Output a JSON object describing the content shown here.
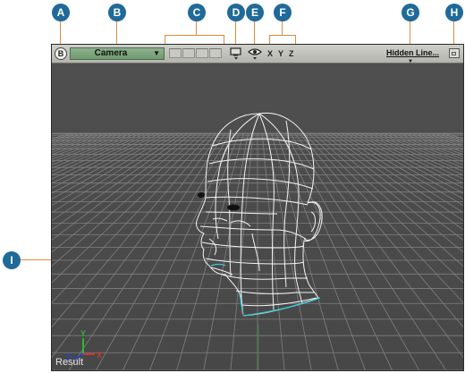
{
  "callouts": [
    "A",
    "B",
    "C",
    "D",
    "E",
    "F",
    "G",
    "H",
    "I"
  ],
  "toolbar": {
    "b_button": "B",
    "camera_menu": "Camera",
    "camera_arrow": "▼",
    "axes": [
      "X",
      "Y",
      "Z"
    ],
    "render_mode": "Hidden Line...",
    "render_mode_arrow": "▼"
  },
  "axis_gizmo": {
    "y": "Y",
    "x": "X",
    "z": "Z"
  },
  "viewport_label": "Result",
  "colors": {
    "callout": "#1f6a99",
    "leader": "#e08a3c",
    "viewport_bg": "#4a4a4a",
    "grid": "#808080",
    "mesh": "#ffffff",
    "neck_outline": "#38c8d8"
  },
  "icons": [
    "b-menu-icon",
    "monitor-icon",
    "eye-icon",
    "maximize-icon"
  ]
}
